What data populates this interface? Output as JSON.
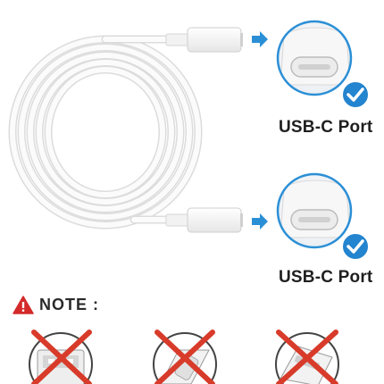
{
  "ports": [
    {
      "label": "USB-C Port",
      "icon": "usb-c-port-icon",
      "status": "supported"
    },
    {
      "label": "USB-C Port",
      "icon": "usb-c-port-icon",
      "status": "supported"
    }
  ],
  "note": {
    "label": "NOTE :",
    "icon": "warning-triangle-icon"
  },
  "unsupported": [
    {
      "icon": "usb-a-port-icon",
      "status": "not-supported"
    },
    {
      "icon": "lightning-port-icon",
      "status": "not-supported"
    },
    {
      "icon": "micro-usb-port-icon",
      "status": "not-supported"
    }
  ],
  "colors": {
    "accent_blue": "#2b8fd6",
    "check_blue": "#2384cf",
    "warning_red": "#d42a2a",
    "cross_red": "#d83b2a",
    "cable_white": "#f7f7f7"
  }
}
